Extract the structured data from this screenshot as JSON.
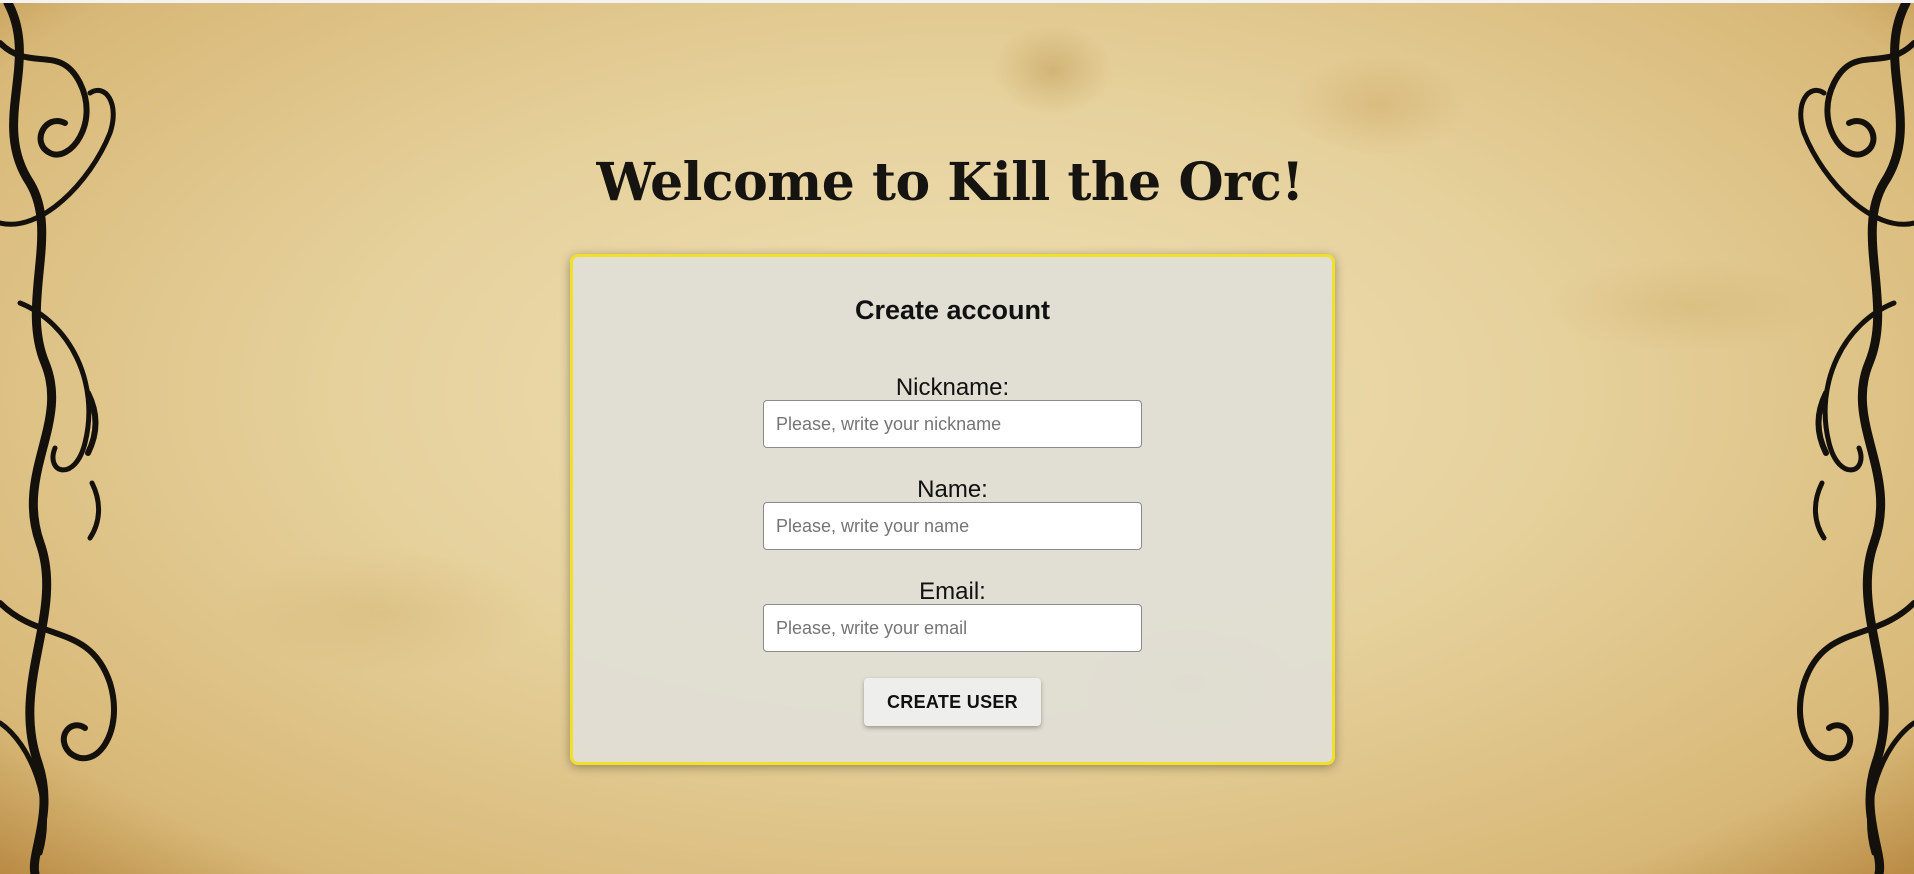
{
  "page": {
    "title": "Welcome to Kill the Orc!"
  },
  "form": {
    "heading": "Create account",
    "fields": [
      {
        "label": "Nickname:",
        "placeholder": "Please, write your nickname",
        "value": ""
      },
      {
        "label": "Name:",
        "placeholder": "Please, write your name",
        "value": ""
      },
      {
        "label": "Email:",
        "placeholder": "Please, write your email",
        "value": ""
      }
    ],
    "submit_label": "CREATE USER"
  },
  "theme": {
    "card_border": "#f0e02a",
    "parchment": "#e6d19c",
    "ornament": "#14110c"
  },
  "decorations": [
    "left-border-ornament",
    "right-border-ornament"
  ]
}
